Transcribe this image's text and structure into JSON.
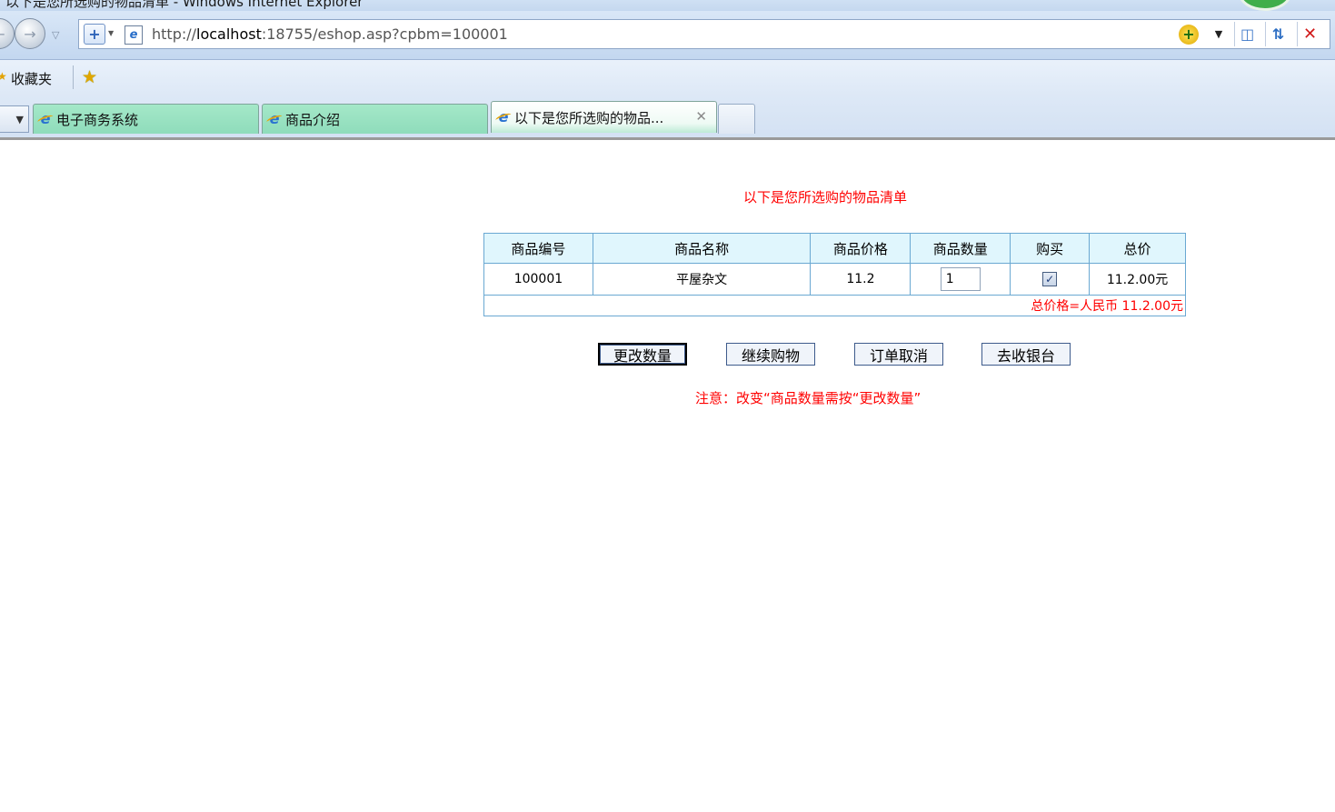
{
  "window": {
    "title": "以下是您所选购的物品清单 - Windows Internet Explorer"
  },
  "addressbar": {
    "url_prefix": "http://",
    "url_host": "localhost",
    "url_rest": ":18755/eshop.asp?cpbm=100001"
  },
  "favorites": {
    "label": "收藏夹"
  },
  "tabs": [
    {
      "label": "电子商务系统",
      "active": false
    },
    {
      "label": "商品介绍",
      "active": false
    },
    {
      "label": "以下是您所选购的物品...",
      "active": true
    }
  ],
  "page": {
    "heading": "以下是您所选购的物品清单",
    "columns": [
      "商品编号",
      "商品名称",
      "商品价格",
      "商品数量",
      "购买",
      "总价"
    ],
    "rows": [
      {
        "code": "100001",
        "name": "平屋杂文",
        "price": "11.2",
        "quantity": "1",
        "buy": true,
        "subtotal": "11.2.00元"
      }
    ],
    "total_text": "总价格=人民币 11.2.00元",
    "buttons": {
      "change_qty": "更改数量",
      "continue": "继续购物",
      "cancel": "订单取消",
      "checkout": "去收银台"
    },
    "note": "注意：改变“商品数量需按“更改数量”"
  },
  "icons": {
    "back": "back-arrow-icon",
    "forward": "forward-arrow-icon",
    "go": "go-icon",
    "compat": "compatibility-view-icon",
    "refresh": "refresh-icon",
    "stop": "stop-icon",
    "favorites_star": "favorites-star-icon",
    "add_favorite": "add-favorite-icon",
    "ie_page": "ie-page-icon"
  },
  "colors": {
    "heading": "#ff0000",
    "table_border": "#6aa8d2",
    "header_bg": "#e0f6fd",
    "tab_bg": "#8fdcbb"
  }
}
